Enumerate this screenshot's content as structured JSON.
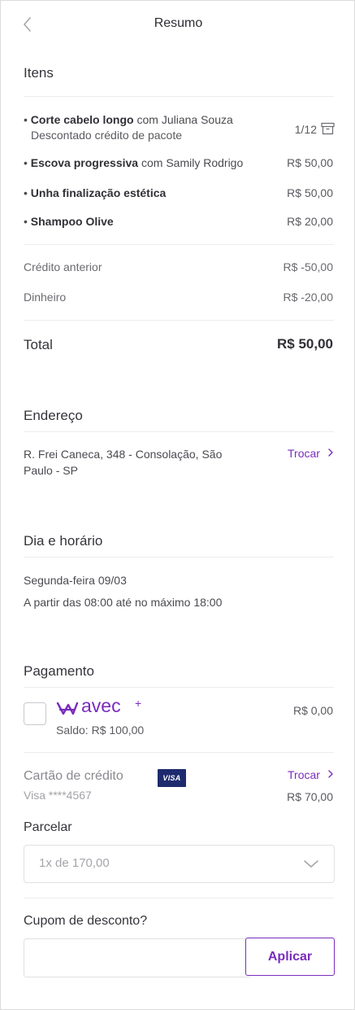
{
  "header": {
    "title": "Resumo"
  },
  "items_section": {
    "title": "Itens",
    "items": [
      {
        "bullet": "•",
        "service": "Corte cabelo longo",
        "with": "com Juliana Souza",
        "note": "Descontado crédito de pacote",
        "value": "1/12"
      },
      {
        "bullet": "•",
        "service": "Escova progressiva",
        "with": "com Samily Rodrigo",
        "value": "R$ 50,00"
      },
      {
        "bullet": "•",
        "service": "Unha finalização estética",
        "with": "",
        "value": "R$ 50,00"
      },
      {
        "bullet": "•",
        "service": "Shampoo Olive",
        "with": "",
        "value": "R$ 20,00"
      }
    ],
    "adjustments": [
      {
        "label": "Crédito anterior",
        "value": "R$ -50,00"
      },
      {
        "label": "Dinheiro",
        "value": "R$ -20,00"
      }
    ],
    "total": {
      "label": "Total",
      "value": "R$ 50,00"
    }
  },
  "address": {
    "title": "Endereço",
    "line1": "R. Frei Caneca, 348 - Consolação, São",
    "line2": "Paulo - SP",
    "change": "Trocar"
  },
  "schedule": {
    "title": "Dia e horário",
    "date": "Segunda-feira 09/03",
    "time": "A partir das 08:00 até no máximo 18:00"
  },
  "payment": {
    "title": "Pagamento",
    "wallet": {
      "brand": "avec",
      "balance": "Saldo: R$ 100,00",
      "value": "R$ 0,00"
    },
    "card": {
      "label": "Cartão de crédito",
      "brand_badge": "VISA",
      "number": "Visa ****4567",
      "change": "Trocar",
      "value": "R$ 70,00"
    },
    "installments": {
      "label": "Parcelar",
      "selected": "1x de 170,00"
    }
  },
  "coupon": {
    "title": "Cupom de desconto?",
    "placeholder": "",
    "button": "Aplicar"
  },
  "colors": {
    "accent": "#7a2bbd",
    "visa": "#1d2a6e"
  },
  "icons": {
    "back": "chevron-left-icon",
    "package": "package-box-icon",
    "change": "chevron-right-icon",
    "select": "chevron-down-icon"
  }
}
